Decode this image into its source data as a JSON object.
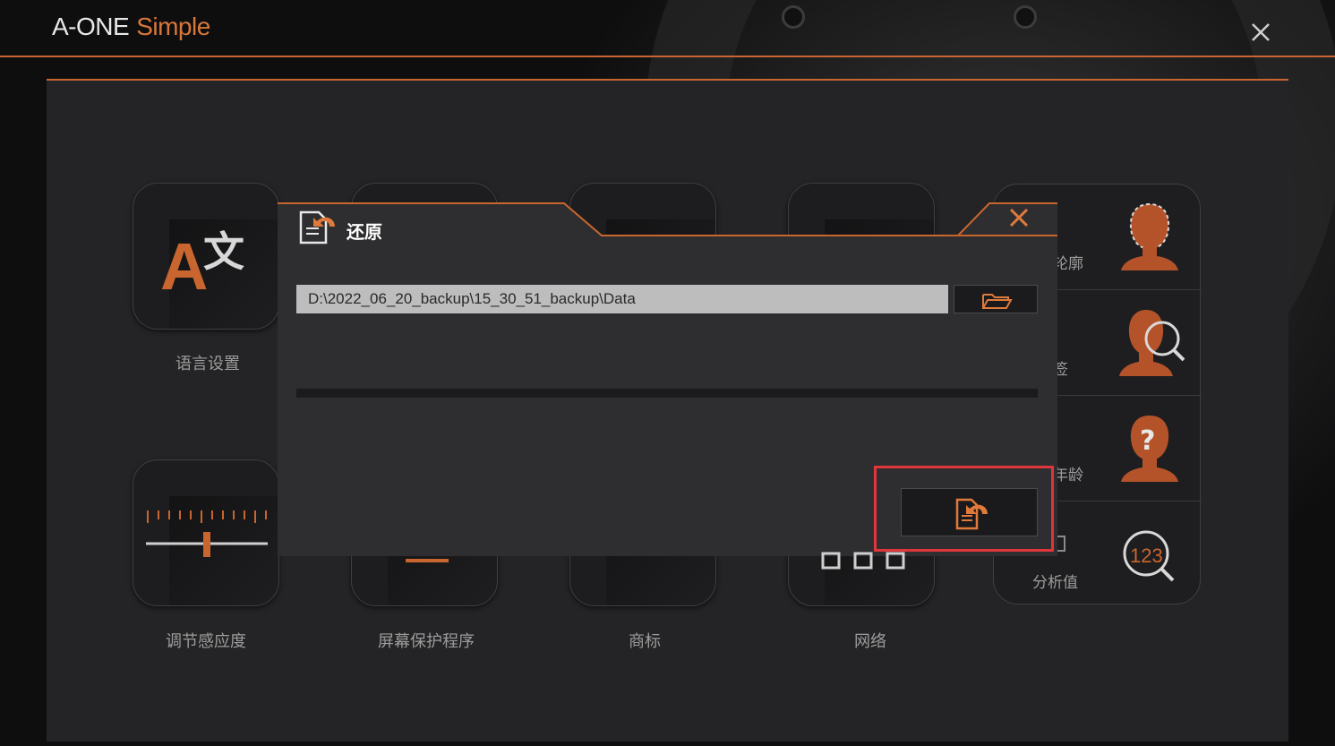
{
  "app": {
    "title_main": "A-ONE",
    "title_sub": "Simple",
    "accent_color": "#c9662f"
  },
  "tiles": [
    {
      "label": "语言设置",
      "icon": "language-icon"
    },
    {
      "label": "",
      "icon": "unknown-icon"
    },
    {
      "label": "",
      "icon": "unknown-icon"
    },
    {
      "label": "",
      "icon": "unknown-icon"
    },
    {
      "label": "调节感应度",
      "icon": "sensitivity-slider-icon"
    },
    {
      "label": "屏幕保护程序",
      "icon": "screensaver-icon"
    },
    {
      "label": "商标",
      "icon": "logo-icon"
    },
    {
      "label": "网络",
      "icon": "network-icon"
    }
  ],
  "side_list": [
    {
      "label": "轮廓",
      "icon": "face-outline-icon"
    },
    {
      "label": "签",
      "icon": "face-search-icon"
    },
    {
      "label": "年龄",
      "icon": "face-question-icon"
    },
    {
      "label": "分析值",
      "icon": "analysis-123-icon"
    }
  ],
  "dialog": {
    "title": "还原",
    "title_icon": "restore-file-icon",
    "path_value": "D:\\2022_06_20_backup\\15_30_51_backup\\Data",
    "browse_icon": "folder-open-icon",
    "progress": 0,
    "restore_icon": "restore-file-icon",
    "close_icon": "close-icon"
  }
}
